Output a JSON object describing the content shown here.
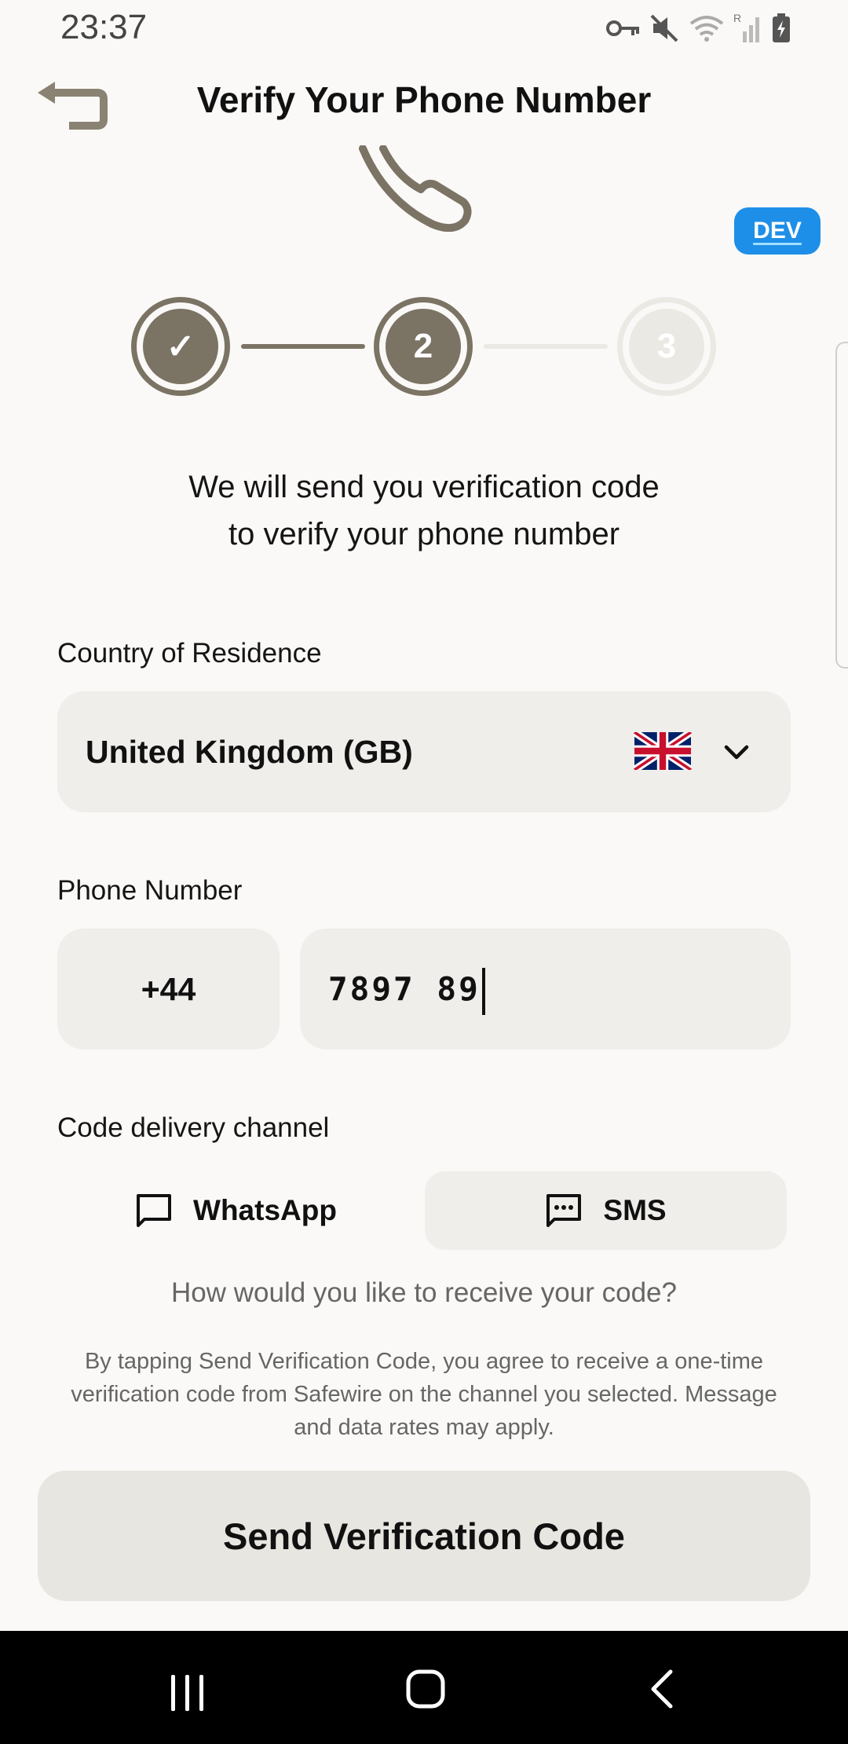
{
  "status_bar": {
    "time": "23:37",
    "icons": [
      "key-icon",
      "mute-icon",
      "wifi-icon",
      "signal-icon",
      "battery-icon"
    ]
  },
  "header": {
    "back_icon": "back-arrow-icon",
    "title": "Verify Your Phone Number"
  },
  "dev_badge": "DEV",
  "stepper": {
    "steps": [
      {
        "label": "✓",
        "state": "done"
      },
      {
        "label": "2",
        "state": "active"
      },
      {
        "label": "3",
        "state": "pending"
      }
    ]
  },
  "intro": {
    "line1": "We will send you verification code",
    "line2": "to verify your phone number"
  },
  "country": {
    "label": "Country of Residence",
    "value": "United Kingdom (GB)",
    "flag_icon": "uk-flag-icon"
  },
  "phone": {
    "label": "Phone Number",
    "country_code": "+44",
    "number": "7897 89"
  },
  "channel": {
    "label": "Code delivery channel",
    "options": [
      {
        "label": "WhatsApp",
        "icon": "chat-bubble-icon",
        "selected": false
      },
      {
        "label": "SMS",
        "icon": "sms-icon",
        "selected": true
      }
    ],
    "hint": "How would you like to receive your code?"
  },
  "disclaimer": {
    "line1": "By tapping Send Verification Code, you agree to receive a one-time",
    "line2": "verification code from Safewire on the channel you selected. Message",
    "line3": "and data rates may apply."
  },
  "send_button": "Send Verification Code",
  "colors": {
    "accent": "#7b7364",
    "inactive_step": "#ebe9e4",
    "field_bg": "#efeeea",
    "dev_badge": "#1e8fe8",
    "background": "#faf9f7"
  }
}
